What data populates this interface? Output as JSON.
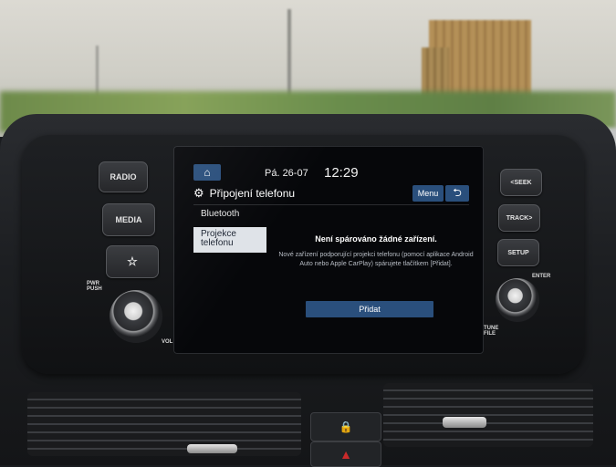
{
  "left_panel": {
    "radio_label": "RADIO",
    "media_label": "MEDIA",
    "fav_label": "☆",
    "pwr_label": "PWR\nPUSH",
    "vol_label": "VOL"
  },
  "right_panel": {
    "seek_label": "<SEEK",
    "track_label": "TRACK>",
    "setup_label": "SETUP",
    "enter_label": "ENTER",
    "tune_label": "TUNE\nFILE"
  },
  "status": {
    "date": "Pá. 26-07",
    "time": "12:29"
  },
  "header": {
    "title": "Připojení telefonu",
    "menu_label": "Menu",
    "back_icon": "⮌"
  },
  "sidebar": {
    "items": [
      {
        "label": "Bluetooth",
        "selected": false
      },
      {
        "label": "Projekce\ntelefonu",
        "selected": true
      }
    ]
  },
  "main": {
    "message_title": "Není spárováno žádné zařízení.",
    "message_body": "Nové zařízení podporující projekci telefonu (pomocí aplikace Android Auto nebo Apple CarPlay) spárujete tlačítkem [Přidat].",
    "add_label": "Přidat"
  },
  "console": {
    "lock_icon": "🔒",
    "hazard_icon": "▲"
  },
  "colors": {
    "accent": "#2a4f7c",
    "selected_bg": "#dfe3e8",
    "screen_bg": "#06070a"
  }
}
